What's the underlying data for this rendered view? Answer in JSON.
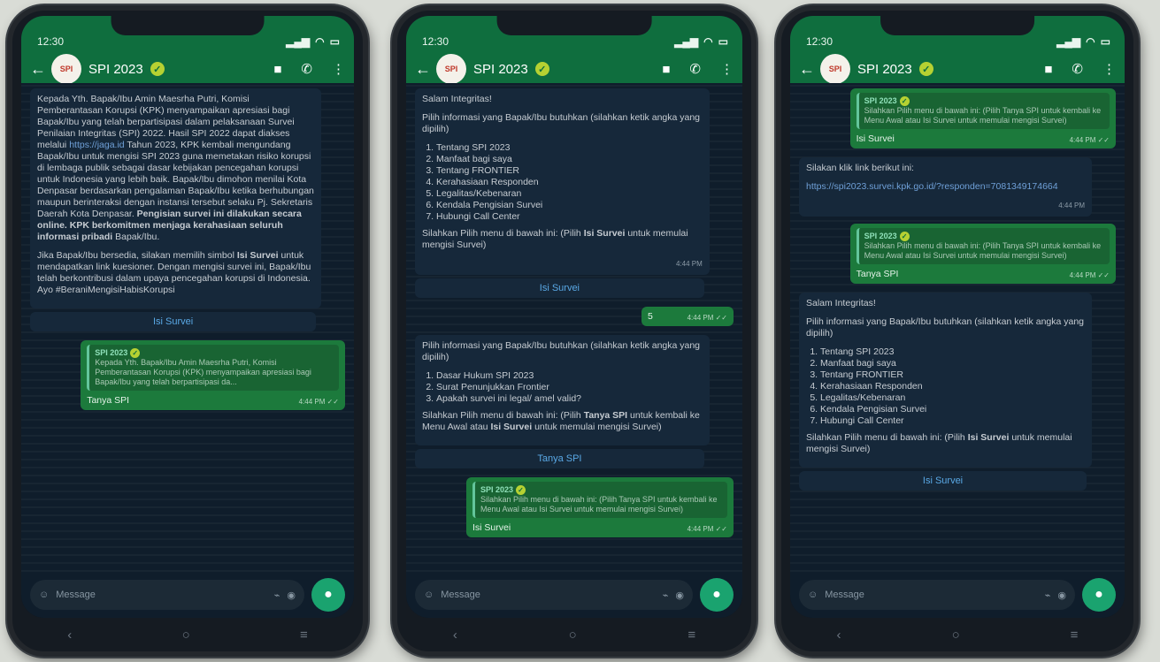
{
  "status": {
    "time": "12:30"
  },
  "header": {
    "title": "SPI 2023",
    "back_icon": "arrow-left-icon",
    "video_icon": "video-icon",
    "call_icon": "phone-icon",
    "menu_icon": "more-vertical-icon"
  },
  "composer": {
    "placeholder": "Message"
  },
  "phone1": {
    "intro": "Kepada Yth. Bapak/Ibu Amin Maesrha Putri, Komisi Pemberantasan Korupsi (KPK) menyampaikan apresiasi bagi Bapak/Ibu yang telah berpartisipasi dalam pelaksanaan Survei Penilaian Integritas (SPI) 2022. Hasil SPI 2022 dapat diakses melalui",
    "link": "https://jaga.id",
    "intro2": "Tahun 2023, KPK kembali mengundang Bapak/Ibu untuk mengisi SPI 2023 guna memetakan risiko korupsi di lembaga publik sebagai dasar kebijakan pencegahan korupsi untuk Indonesia yang lebih baik. Bapak/Ibu dimohon menilai Kota Denpasar berdasarkan pengalaman Bapak/Ibu ketika berhubungan maupun berinteraksi dengan instansi tersebut selaku Pj. Sekretaris Daerah Kota Denpasar.",
    "bold1": "Pengisian survei ini dilakukan secara online. KPK berkomitmen menjaga kerahasiaan seluruh informasi pribadi",
    "intro3": "Bapak/Ibu.",
    "para2a": "Jika Bapak/Ibu bersedia, silakan memilih simbol",
    "para2bold": "Isi Survei",
    "para2b": "untuk mendapatkan link kuesioner. Dengan mengisi survei ini, Bapak/Ibu telah berkontribusi dalam upaya pencegahan korupsi di Indonesia. Ayo #BeraniMengisiHabisKorupsi",
    "button": "Isi Survei",
    "reply_quote_name": "SPI 2023",
    "reply_quote_text": "Kepada Yth. Bapak/Ibu Amin Maesrha Putri, Komisi Pemberantasan Korupsi (KPK) menyampaikan apresiasi bagi Bapak/Ibu yang telah berpartisipasi da...",
    "reply_text": "Tanya SPI",
    "reply_time": "4:44 PM ✓✓"
  },
  "phone2": {
    "greeting": "Salam Integritas!",
    "menu_intro": "Pilih informasi yang Bapak/Ibu butuhkan (silahkan ketik angka yang dipilih)",
    "menu": [
      "Tentang SPI 2023",
      "Manfaat bagi saya",
      "Tentang FRONTIER",
      "Kerahasiaan Responden",
      "Legalitas/Kebenaran",
      "Kendala Pengisian Survei",
      "Hubungi Call Center"
    ],
    "choose_a": "Silahkan Pilih menu di bawah ini: (Pilih",
    "choose_bold": "Isi Survei",
    "choose_b": "untuk memulai mengisi Survei)",
    "time1": "4:44 PM",
    "button1": "Isi Survei",
    "sent_text": "5",
    "sent_time": "4:44 PM ✓✓",
    "menu2_intro": "Pilih informasi yang Bapak/Ibu butuhkan (silahkan ketik angka yang dipilih)",
    "menu2": [
      "Dasar Hukum SPI 2023",
      "Surat Penunjukkan Frontier",
      "Apakah survei ini legal/ amel valid?"
    ],
    "choose2_a": "Silahkan Pilih menu di bawah ini: (Pilih",
    "choose2_bold1": "Tanya SPI",
    "choose2_mid": "untuk kembali ke Menu Awal atau",
    "choose2_bold2": "Isi Survei",
    "choose2_b": "untuk memulai mengisi Survei)",
    "button2": "Tanya SPI",
    "reply_quote_name": "SPI 2023",
    "reply_quote_text": "Silahkan Pilih menu di bawah ini: (Pilih Tanya SPI untuk kembali ke Menu Awal atau Isi Survei untuk memulai mengisi Survei)",
    "reply_text": "Isi Survei",
    "reply_time": "4:44 PM ✓✓"
  },
  "phone3": {
    "top_quote_name": "SPI 2023",
    "top_quote_text": "Silahkan Pilih menu di bawah ini: (Pilih Tanya SPI untuk kembali ke Menu Awal atau Isi Survei untuk memulai mengisi Survei)",
    "top_reply": "Isi Survei",
    "top_time": "4:44 PM ✓✓",
    "link_intro": "Silakan klik link berikut ini:",
    "link": "https://spi2023.survei.kpk.go.id/?responden=7081349174664",
    "link_time": "4:44 PM",
    "reply_quote_name": "SPI 2023",
    "reply_quote_text": "Silahkan Pilih menu di bawah ini: (Pilih Tanya SPI untuk kembali ke Menu Awal atau Isi Survei untuk memulai mengisi Survei)",
    "reply_text": "Tanya SPI",
    "reply_time": "4:44 PM ✓✓",
    "greeting": "Salam Integritas!",
    "menu_intro": "Pilih informasi yang Bapak/Ibu butuhkan (silahkan ketik angka yang dipilih)",
    "menu": [
      "Tentang SPI 2023",
      "Manfaat bagi saya",
      "Tentang FRONTIER",
      "Kerahasiaan Responden",
      "Legalitas/Kebenaran",
      "Kendala Pengisian Survei",
      "Hubungi Call Center"
    ],
    "choose_a": "Silahkan Pilih menu di bawah ini: (Pilih",
    "choose_bold": "Isi Survei",
    "choose_b": "untuk memulai mengisi Survei)",
    "button": "Isi Survei"
  }
}
